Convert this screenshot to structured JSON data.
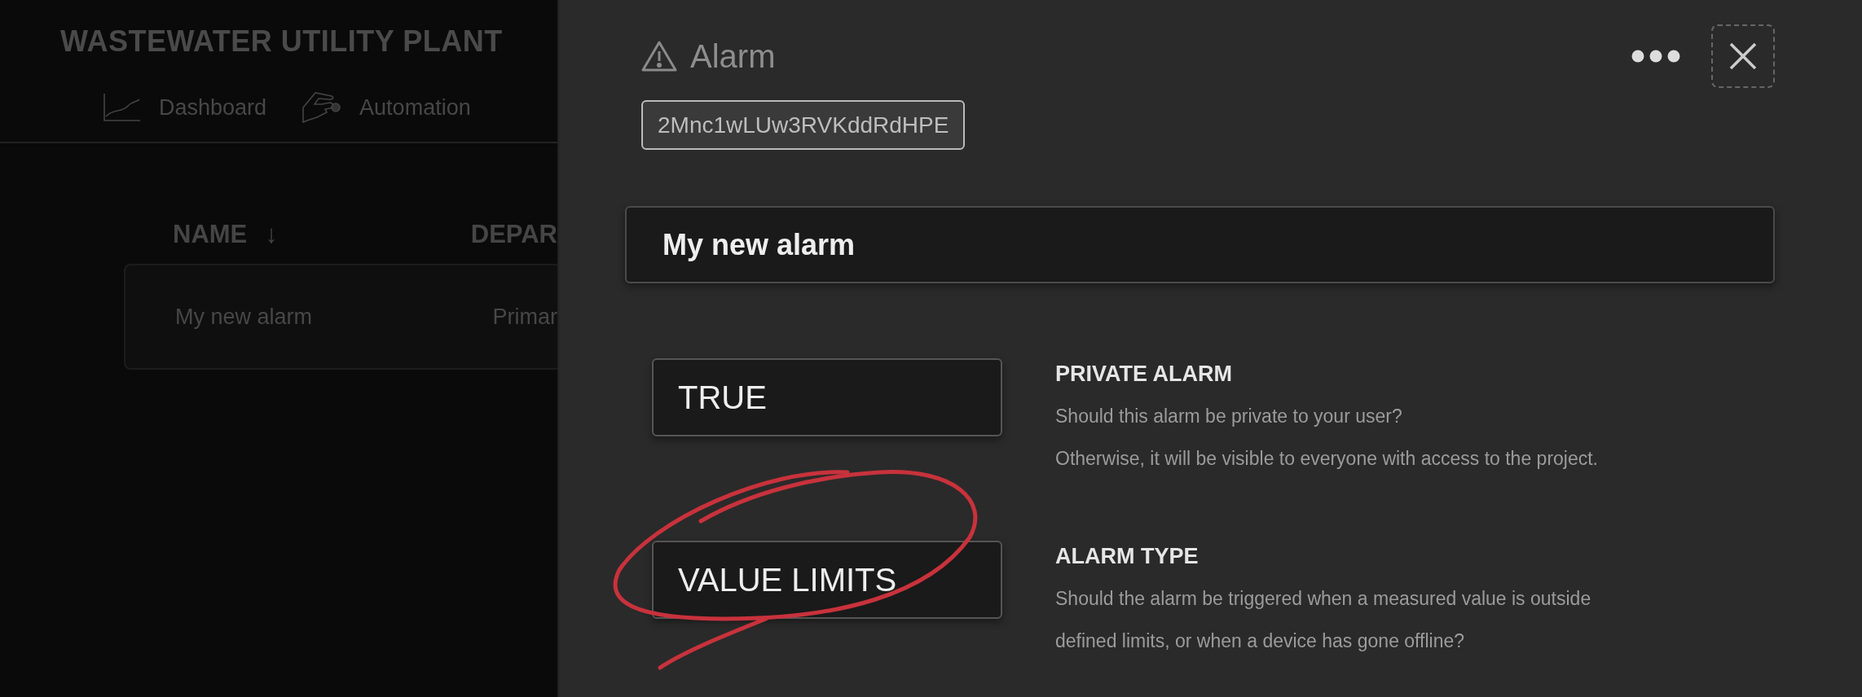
{
  "plant": {
    "title": "WASTEWATER UTILITY PLANT",
    "nav": [
      {
        "label": "Dashboard"
      },
      {
        "label": "Automation"
      }
    ],
    "table": {
      "columns": [
        {
          "label": "NAME",
          "sort_arrow": "↓"
        },
        {
          "label": "DEPAR"
        }
      ],
      "rows": [
        {
          "cells": [
            "My new alarm",
            "Primar"
          ]
        }
      ]
    }
  },
  "drawer": {
    "title": "Alarm",
    "id": "2Mnc1wLUw3RVKddRdHPE",
    "name_value": "My new alarm",
    "settings": [
      {
        "value": "TRUE",
        "label": "PRIVATE ALARM",
        "description_lines": [
          "Should this alarm be private to your user?",
          "Otherwise, it will be visible to everyone with access to the project."
        ]
      },
      {
        "value": "VALUE LIMITS",
        "label": "ALARM TYPE",
        "description_lines": [
          "Should the alarm be triggered when a measured value is outside",
          "defined limits, or when a device has gone offline?"
        ]
      }
    ]
  }
}
